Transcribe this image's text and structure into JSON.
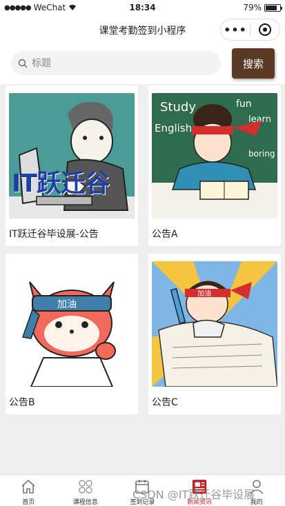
{
  "status_bar": {
    "carrier": "WeChat",
    "time": "18:34",
    "battery": "79%",
    "battery_level": 0.79
  },
  "nav": {
    "title": "课堂考勤签到小程序"
  },
  "search": {
    "placeholder": "标题",
    "button_label": "搜索"
  },
  "cards": [
    {
      "caption": "IT跃迁谷毕设展-公告",
      "image": "cartoon-programmer",
      "image_text": "IT跃迁谷"
    },
    {
      "caption": "公告A",
      "image": "cartoon-student-studying",
      "image_words": [
        "Study",
        "fun",
        "learn",
        "English",
        "boring"
      ]
    },
    {
      "caption": "公告B",
      "image": "cartoon-fox-cheering",
      "headband_text": "加油"
    },
    {
      "caption": "公告C",
      "image": "cartoon-student-exam",
      "headband_text": "加油"
    }
  ],
  "tabs": [
    {
      "label": "首页",
      "icon": "home-icon",
      "active": false
    },
    {
      "label": "课程信息",
      "icon": "grid-icon",
      "active": false
    },
    {
      "label": "签到记录",
      "icon": "calendar-icon",
      "active": false
    },
    {
      "label": "新闻资讯",
      "icon": "news-icon",
      "active": true
    },
    {
      "label": "我的",
      "icon": "user-icon",
      "active": false
    }
  ],
  "watermark": "CSDN @IT跃迁谷毕设展",
  "colors": {
    "accent": "#5a3a22",
    "active_tab": "#c52222"
  }
}
